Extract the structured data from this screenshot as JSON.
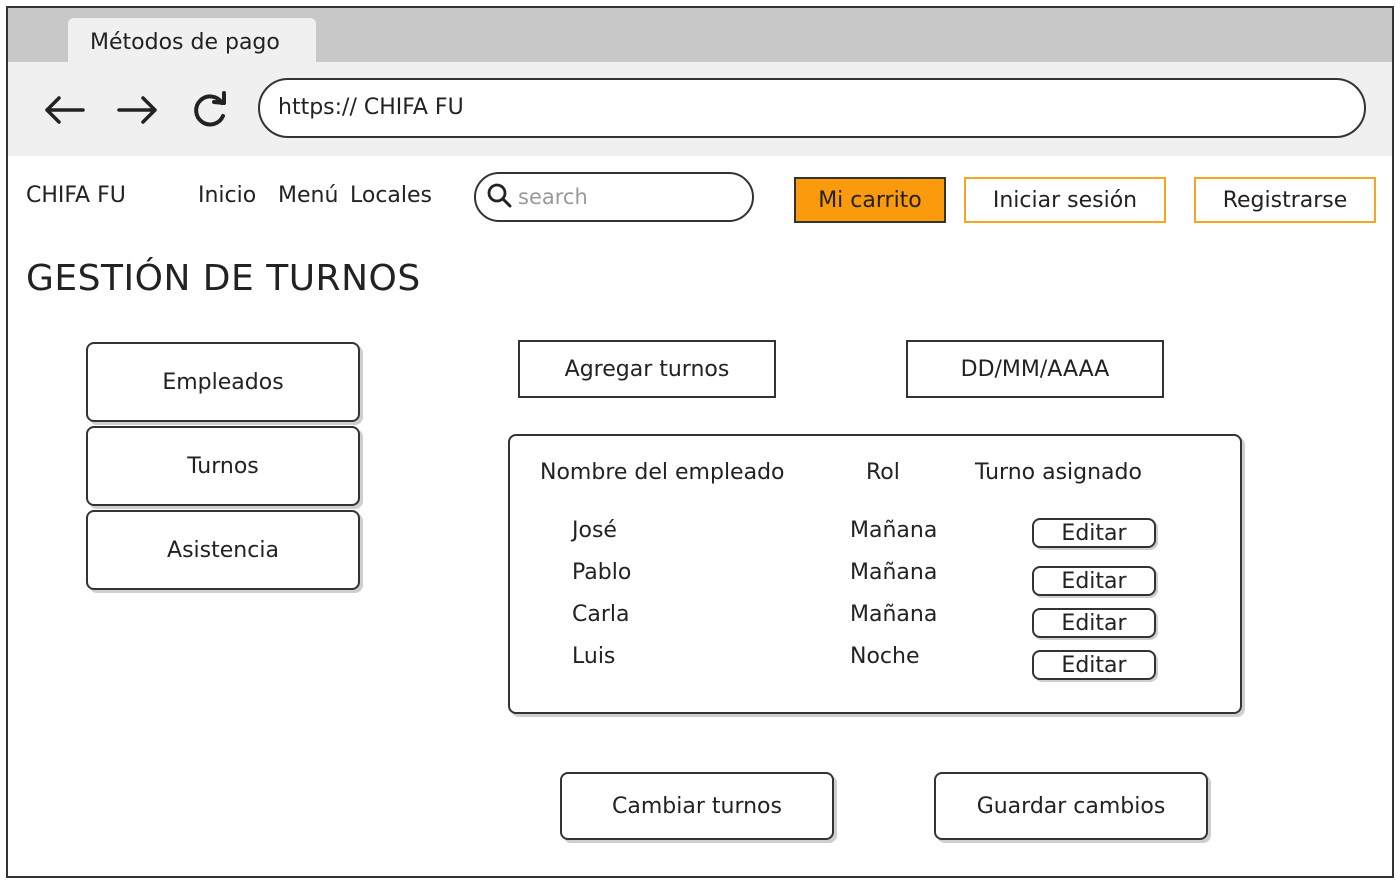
{
  "browser": {
    "tab_title": "Métodos de pago",
    "url": "https:// CHIFA FU"
  },
  "navbar": {
    "brand": "CHIFA FU",
    "links": [
      "Inicio",
      "Menú",
      "Locales"
    ],
    "search_placeholder": "search",
    "cart_label": "Mi carrito",
    "login_label": "Iniciar sesión",
    "register_label": "Registrarse"
  },
  "page": {
    "title": "GESTIÓN DE TURNOS"
  },
  "sidebar": {
    "items": [
      "Empleados",
      "Turnos",
      "Asistencia"
    ]
  },
  "actions": {
    "add_shifts": "Agregar turnos",
    "date_placeholder": "DD/MM/AAAA",
    "change_shifts": "Cambiar turnos",
    "save_changes": "Guardar cambios"
  },
  "table": {
    "columns": [
      "Nombre del empleado",
      "Rol",
      "Turno asignado"
    ],
    "rows": [
      {
        "name": "José",
        "shift": "Mañana",
        "action": "Editar"
      },
      {
        "name": "Pablo",
        "shift": "Mañana",
        "action": "Editar"
      },
      {
        "name": "Carla",
        "shift": "Mañana",
        "action": "Editar"
      },
      {
        "name": "Luis",
        "shift": "Noche",
        "action": "Editar"
      }
    ]
  },
  "colors": {
    "accent": "#fb9a0c",
    "outline_accent": "#f5a623"
  }
}
